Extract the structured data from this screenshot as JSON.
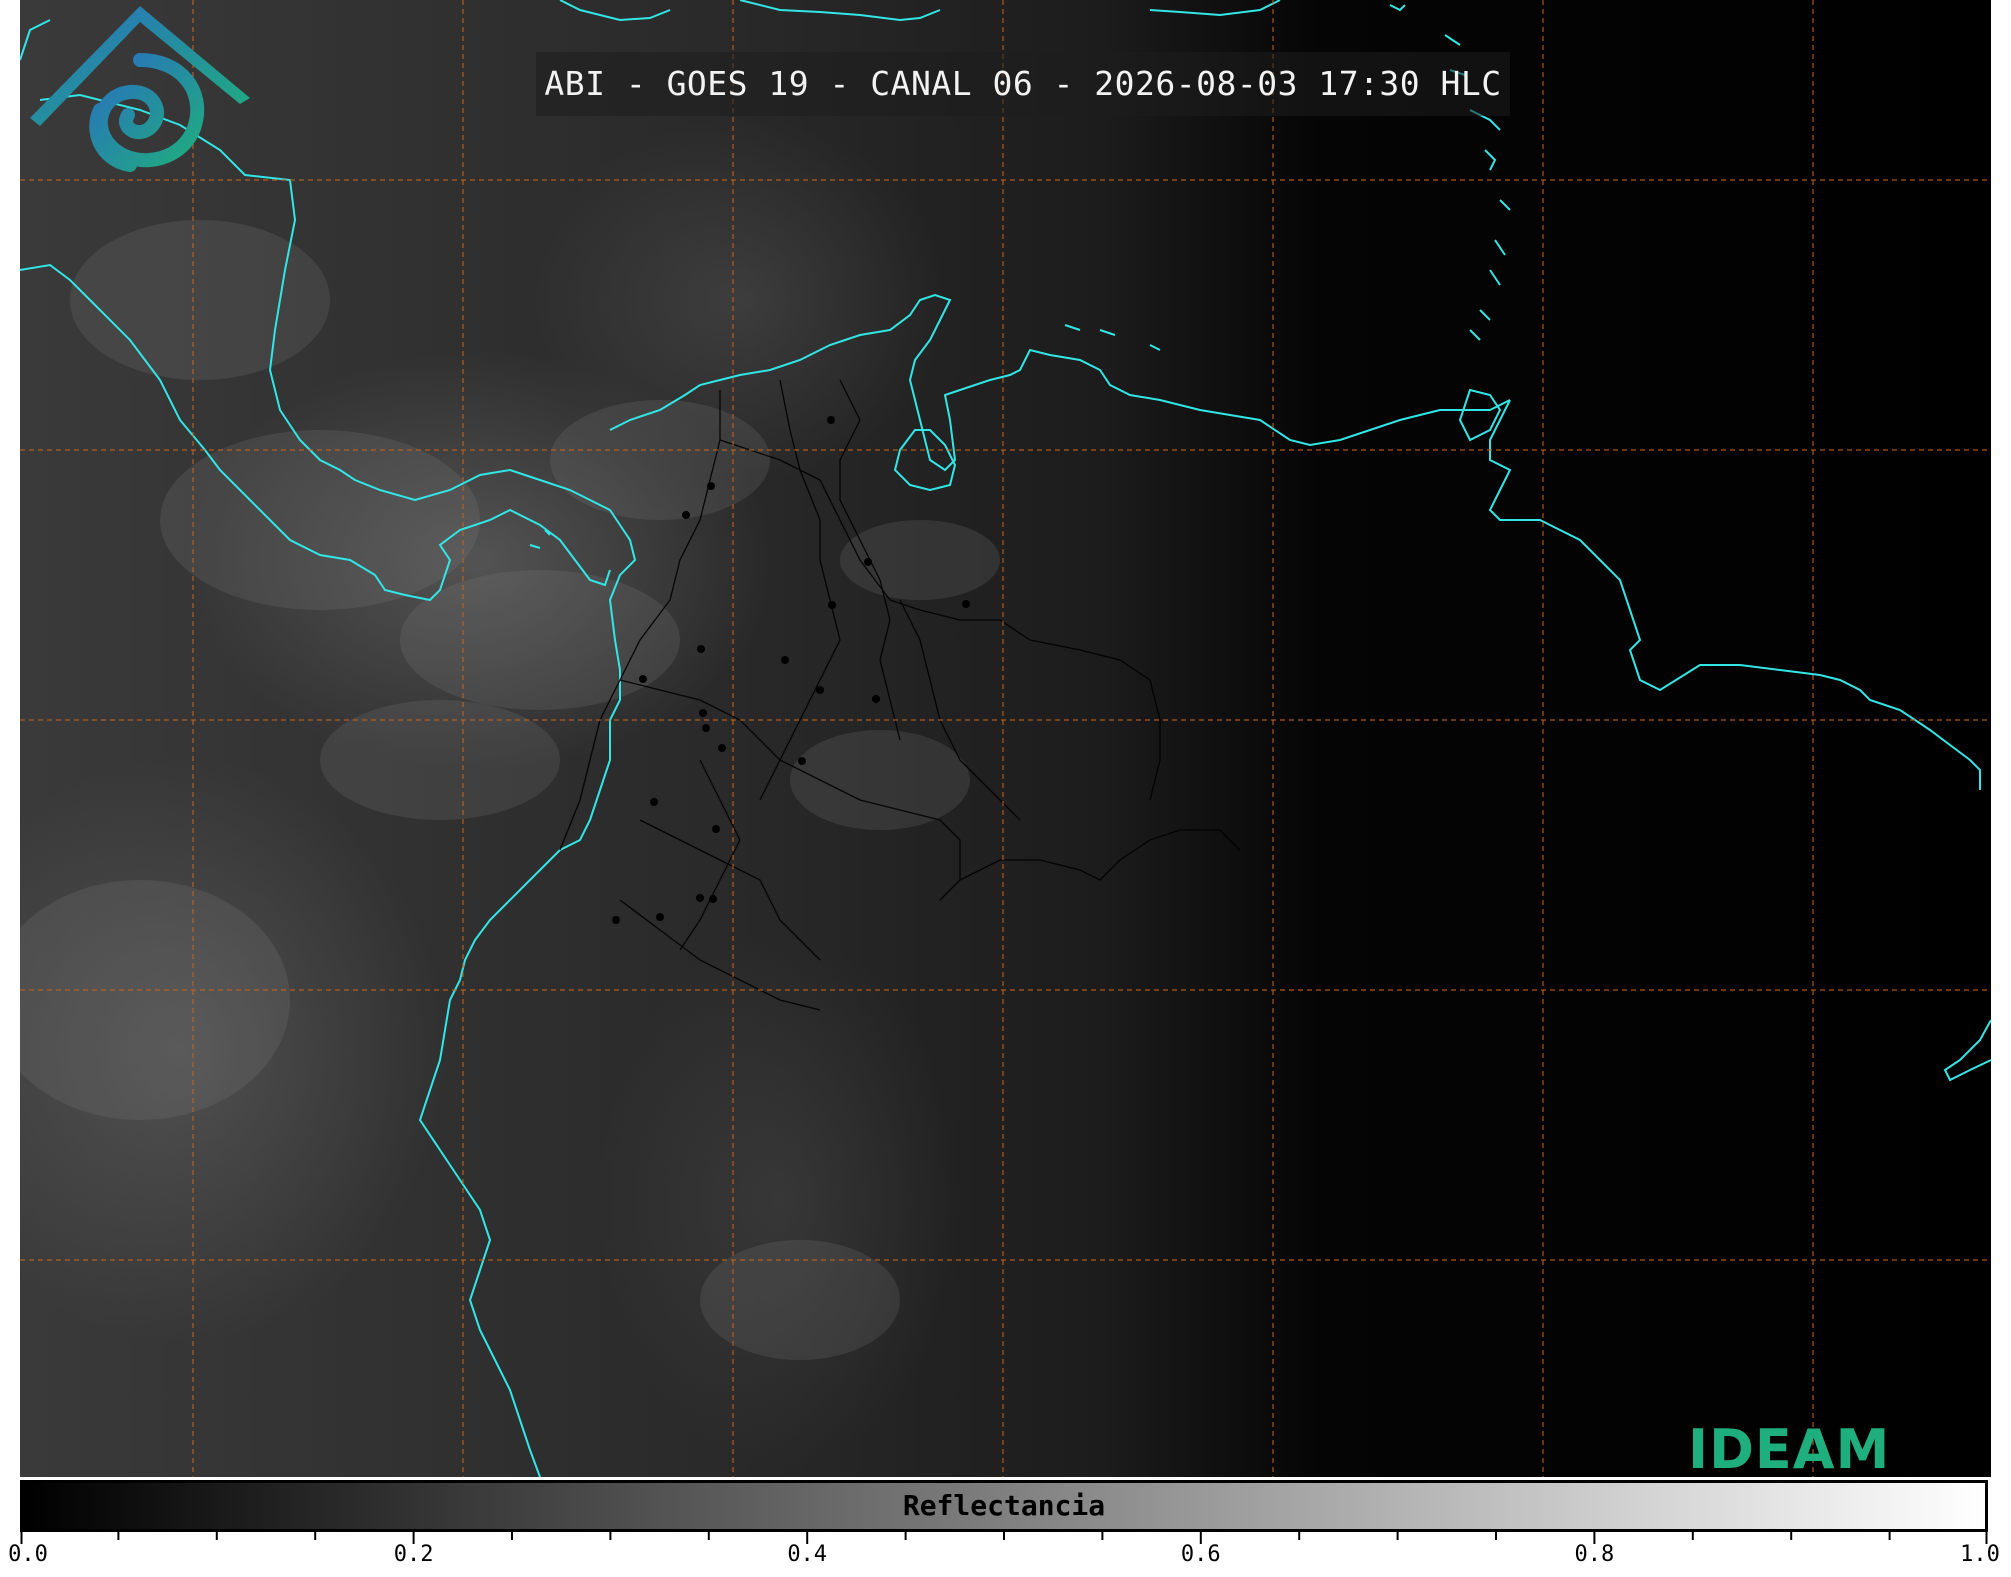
{
  "title": "ABI - GOES 19 - CANAL 06 - 2026-08-03 17:30 HLC",
  "colorbar": {
    "label": "Reflectancia",
    "min": 0.0,
    "max": 1.0,
    "major_ticks": [
      "0.0",
      "0.2",
      "0.4",
      "0.6",
      "0.8",
      "1.0"
    ],
    "minor_tick_step": 0.05,
    "gradient": [
      "#000000",
      "#ffffff"
    ]
  },
  "logo": {
    "text": "IDEAM",
    "color": "#1fae7d",
    "accent_color": "#2a7fc0"
  },
  "map": {
    "coastline_color": "#33e6e6",
    "border_color": "#000000",
    "grid_color": "#c8651e",
    "grid_style": "dashed"
  }
}
